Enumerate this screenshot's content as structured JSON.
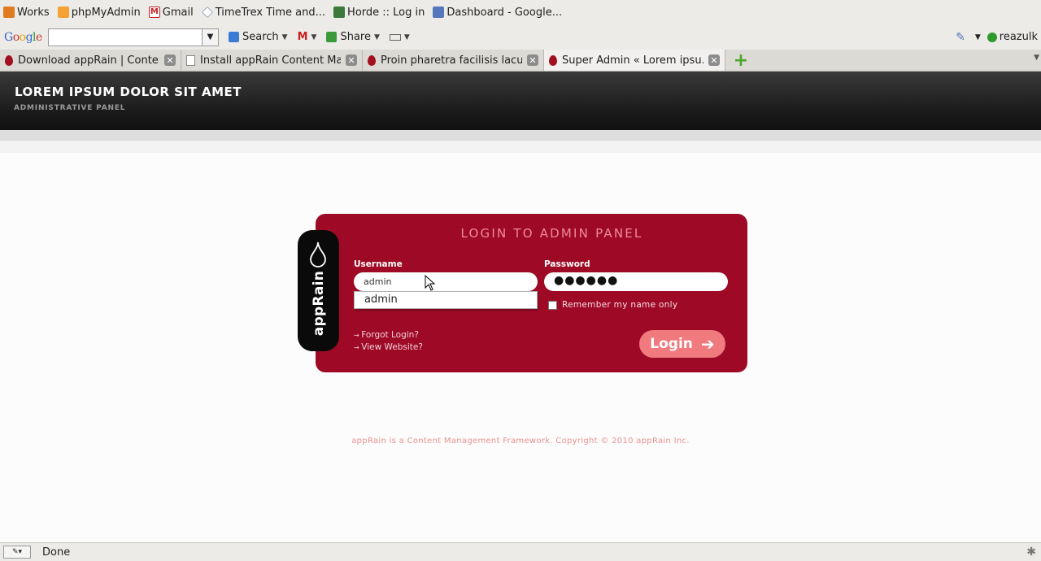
{
  "bookmarks": [
    {
      "label": "Works",
      "icon": "folder-icon",
      "color": "#e07b20"
    },
    {
      "label": "phpMyAdmin",
      "icon": "phpmyadmin-icon",
      "color": "#f3a233"
    },
    {
      "label": "Gmail",
      "icon": "gmail-icon",
      "color": "#cc2020"
    },
    {
      "label": "TimeTrex Time and...",
      "icon": "timetrex-icon",
      "color": "#7788aa"
    },
    {
      "label": "Horde :: Log in",
      "icon": "horde-icon",
      "color": "#3b7a3b"
    },
    {
      "label": "Dashboard - Google...",
      "icon": "dashboard-icon",
      "color": "#5577bb"
    }
  ],
  "google_toolbar": {
    "logo": [
      "G",
      "o",
      "o",
      "g",
      "l",
      "e"
    ],
    "search_value": "",
    "search_label": "Search",
    "share_label": "Share",
    "user": "reazulk"
  },
  "tabs": [
    {
      "title": "Download appRain | Conten...",
      "active": false
    },
    {
      "title": "Install appRain Content Ma...",
      "active": false
    },
    {
      "title": "Proin pharetra facilisis lacu...",
      "active": false
    },
    {
      "title": "Super Admin « Lorem ipsu...",
      "active": true
    }
  ],
  "site": {
    "title": "LOREM IPSUM DOLOR SIT AMET",
    "subtitle": "ADMINISTRATIVE PANEL"
  },
  "login": {
    "brand": "appRain",
    "heading": "LOGIN TO ADMIN PANEL",
    "username_label": "Username",
    "username_value": "admin",
    "password_label": "Password",
    "password_mask": "●●●●●●",
    "autocomplete_option": "admin",
    "remember_label": "Remember my name only",
    "forgot_link": "Forgot Login?",
    "view_link": "View Website?",
    "login_button": "Login"
  },
  "footer": "appRain is a Content Management Framework. Copyright © 2010 appRain Inc.",
  "status": "Done",
  "colors": {
    "panel": "#9e0a26",
    "button": "#f07a7e",
    "header": "#1a1a1a"
  }
}
